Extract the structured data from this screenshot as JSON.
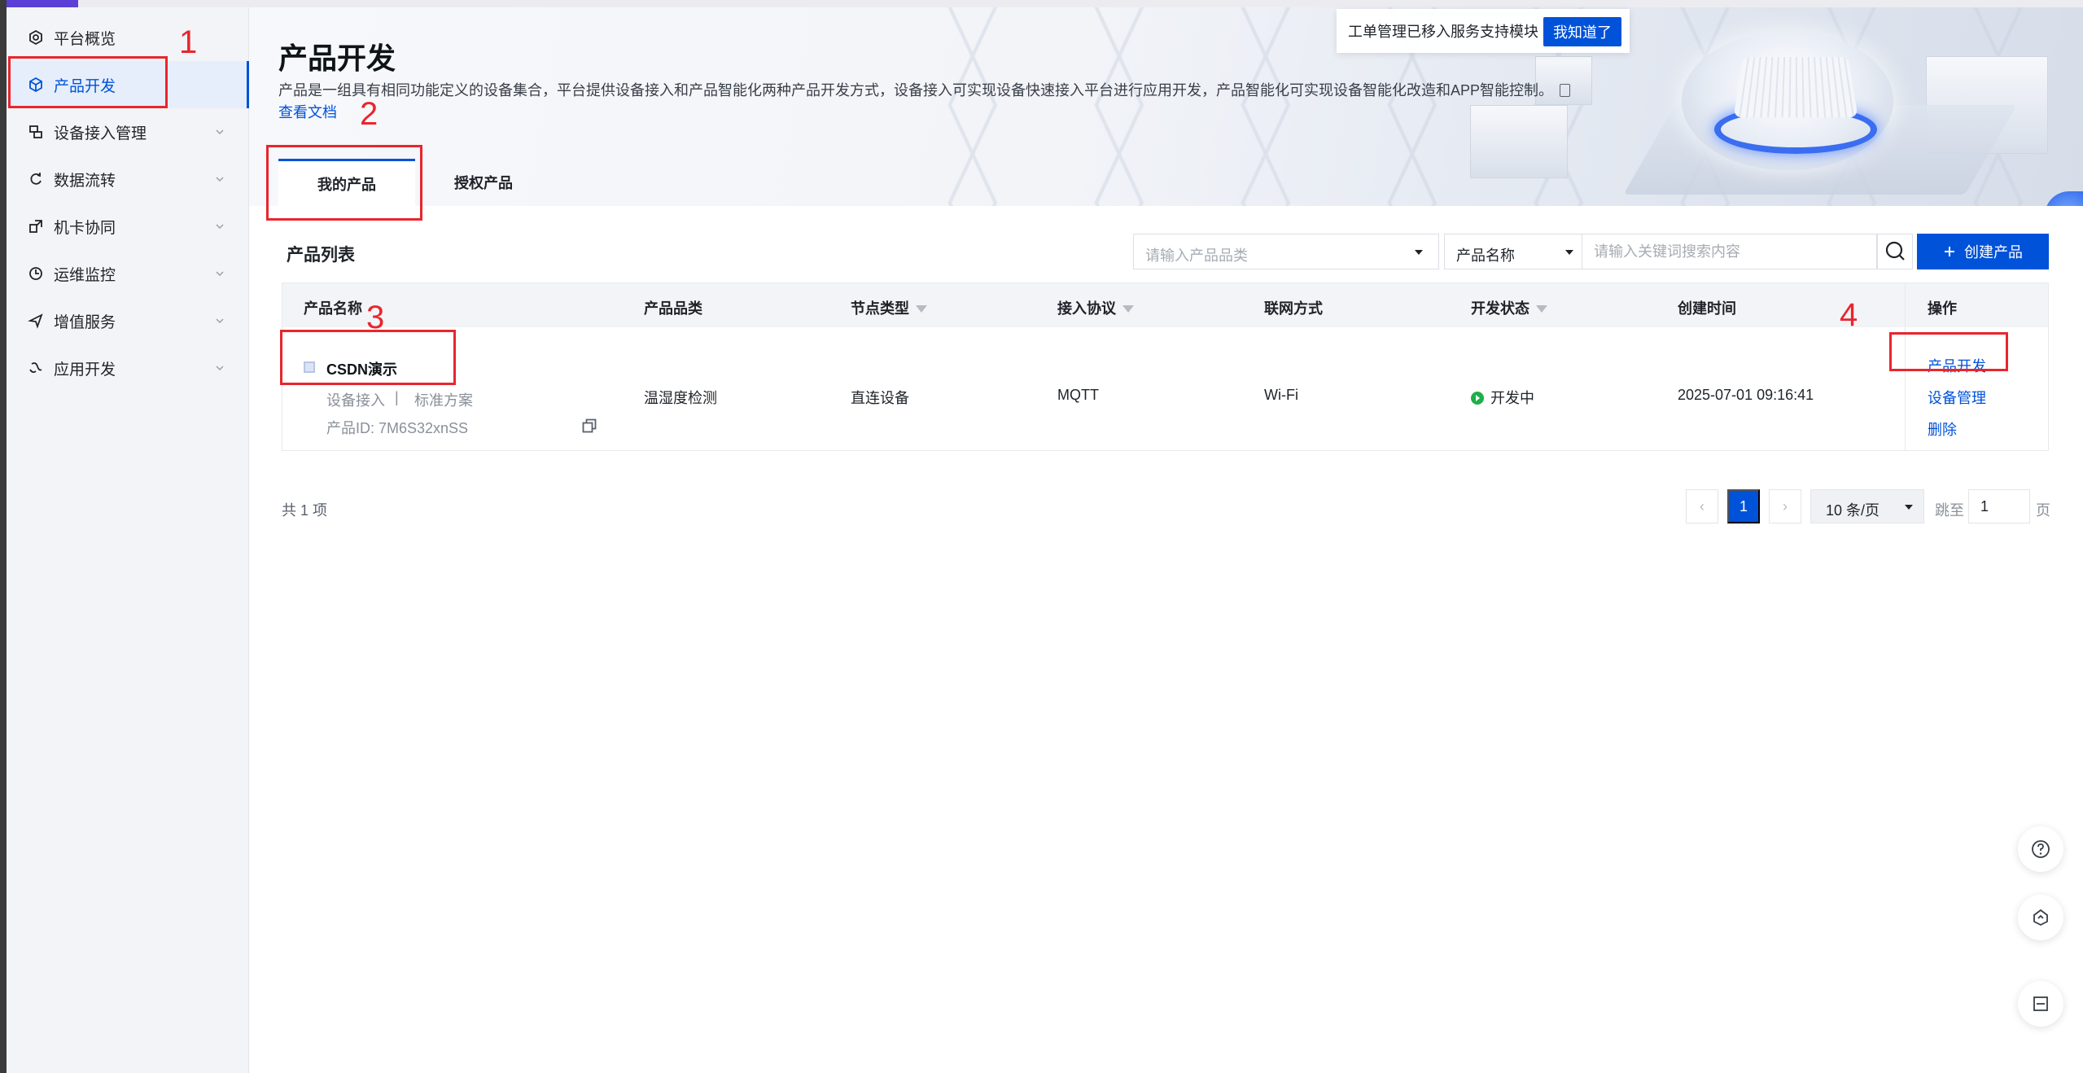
{
  "sidebar": {
    "items": [
      {
        "label": "平台概览",
        "icon": "overview-icon",
        "active": false,
        "expandable": false
      },
      {
        "label": "产品开发",
        "icon": "product-cube-icon",
        "active": true,
        "expandable": false
      },
      {
        "label": "设备接入管理",
        "icon": "device-access-icon",
        "active": false,
        "expandable": true
      },
      {
        "label": "数据流转",
        "icon": "data-flow-icon",
        "active": false,
        "expandable": true
      },
      {
        "label": "机卡协同",
        "icon": "card-sync-icon",
        "active": false,
        "expandable": true
      },
      {
        "label": "运维监控",
        "icon": "monitor-icon",
        "active": false,
        "expandable": true
      },
      {
        "label": "增值服务",
        "icon": "value-service-icon",
        "active": false,
        "expandable": true
      },
      {
        "label": "应用开发",
        "icon": "app-dev-icon",
        "active": false,
        "expandable": true
      }
    ]
  },
  "header": {
    "title": "产品开发",
    "description": "产品是一组具有相同功能定义的设备集合，平台提供设备接入和产品智能化两种产品开发方式，设备接入可实现设备快速接入平台进行应用开发，产品智能化可实现设备智能化改造和APP智能控制。",
    "doc_link": "查看文档"
  },
  "notice": {
    "text": "工单管理已移入服务支持模块",
    "button": "我知道了"
  },
  "tabs": [
    {
      "label": "我的产品",
      "active": true
    },
    {
      "label": "授权产品",
      "active": false
    }
  ],
  "list": {
    "title": "产品列表",
    "category_placeholder": "请输入产品品类",
    "search_field": "产品名称",
    "search_placeholder": "请输入关键词搜索内容",
    "create_button": "创建产品"
  },
  "table": {
    "columns": [
      "产品名称",
      "产品品类",
      "节点类型",
      "接入协议",
      "联网方式",
      "开发状态",
      "创建时间",
      "操作"
    ],
    "rows": [
      {
        "name": "CSDN演示",
        "access_type": "设备接入",
        "separator": "|",
        "solution": "标准方案",
        "product_id": "产品ID:  7M6S32xnSS",
        "category": "温湿度检测",
        "node_type": "直连设备",
        "protocol": "MQTT",
        "network": "Wi-Fi",
        "status": "开发中",
        "created": "2025-07-01 09:16:41",
        "actions": [
          "产品开发",
          "设备管理",
          "删除"
        ]
      }
    ]
  },
  "pagination": {
    "total": "共 1 项",
    "prev": "‹",
    "current": "1",
    "next": "›",
    "page_size": "10 条/页",
    "jump_label": "跳至",
    "jump_value": "1",
    "page_label": "页"
  },
  "annotations": [
    "1",
    "2",
    "3",
    "4"
  ],
  "colors": {
    "accent": "#0052d9",
    "annotation": "#e8262d",
    "status_green": "#1cb049"
  }
}
